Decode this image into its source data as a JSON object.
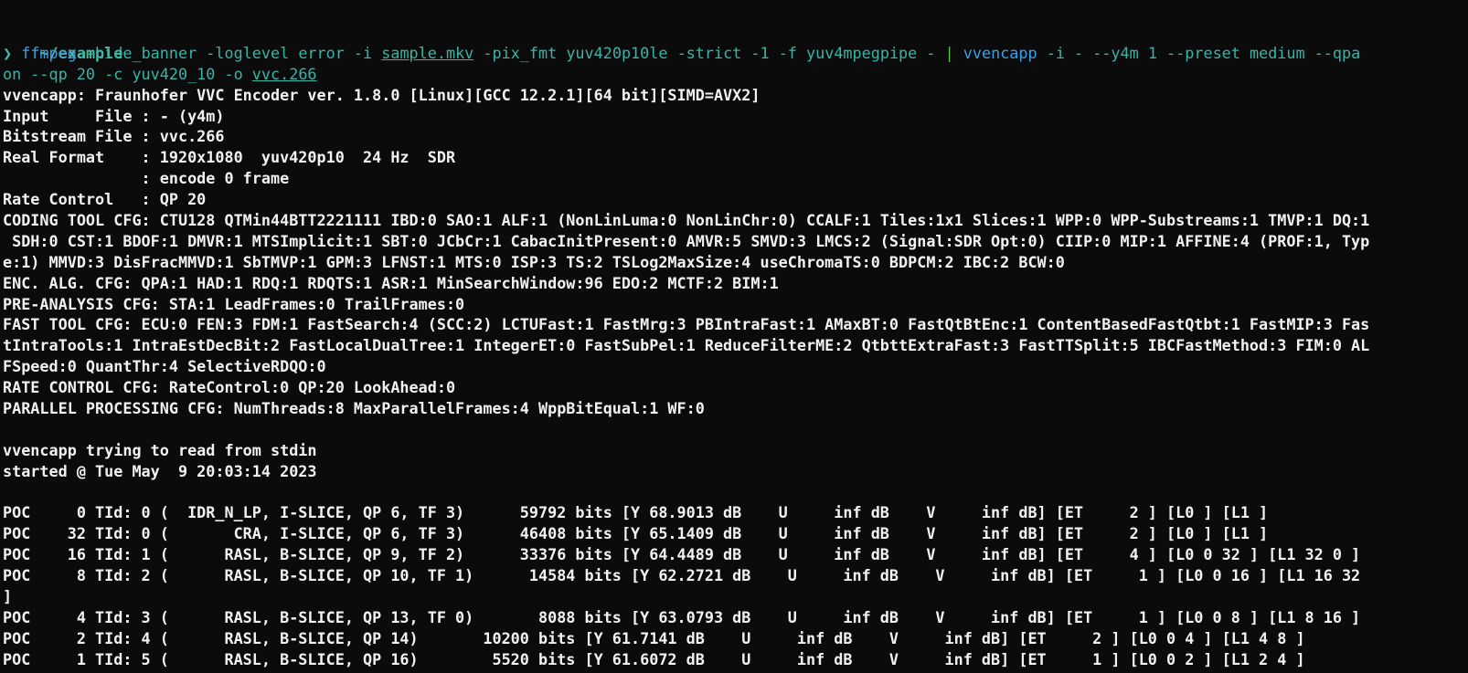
{
  "cwd": "~/example",
  "prompt_symbol": "❯",
  "command": {
    "line1_cmd1": "ffmpeg",
    "line1_args1": " -hide_banner -loglevel error -i ",
    "line1_file1": "sample.mkv",
    "line1_args2": " -pix_fmt yuv420p10le -strict -1 -f yuv4mpegpipe - ",
    "pipe": "|",
    "line1_cmd2": " vvencapp",
    "line1_args3": " -i - --y4m 1 --preset medium --qpa",
    "line2_args": "on --qp 20 -c yuv420_10 -o ",
    "line2_file": "vvc.266"
  },
  "output_lines": [
    "vvencapp: Fraunhofer VVC Encoder ver. 1.8.0 [Linux][GCC 12.2.1][64 bit][SIMD=AVX2]",
    "Input     File : - (y4m)",
    "Bitstream File : vvc.266",
    "Real Format    : 1920x1080  yuv420p10  24 Hz  SDR",
    "               : encode 0 frame",
    "Rate Control   : QP 20",
    "CODING TOOL CFG: CTU128 QTMin44BTT2221111 IBD:0 SAO:1 ALF:1 (NonLinLuma:0 NonLinChr:0) CCALF:1 Tiles:1x1 Slices:1 WPP:0 WPP-Substreams:1 TMVP:1 DQ:1",
    " SDH:0 CST:1 BDOF:1 DMVR:1 MTSImplicit:1 SBT:0 JCbCr:1 CabacInitPresent:0 AMVR:5 SMVD:3 LMCS:2 (Signal:SDR Opt:0) CIIP:0 MIP:1 AFFINE:4 (PROF:1, Typ",
    "e:1) MMVD:3 DisFracMMVD:1 SbTMVP:1 GPM:3 LFNST:1 MTS:0 ISP:3 TS:2 TSLog2MaxSize:4 useChromaTS:0 BDPCM:2 IBC:2 BCW:0",
    "ENC. ALG. CFG: QPA:1 HAD:1 RDQ:1 RDQTS:1 ASR:1 MinSearchWindow:96 EDO:2 MCTF:2 BIM:1",
    "PRE-ANALYSIS CFG: STA:1 LeadFrames:0 TrailFrames:0",
    "FAST TOOL CFG: ECU:0 FEN:3 FDM:1 FastSearch:4 (SCC:2) LCTUFast:1 FastMrg:3 PBIntraFast:1 AMaxBT:0 FastQtBtEnc:1 ContentBasedFastQtbt:1 FastMIP:3 Fas",
    "tIntraTools:1 IntraEstDecBit:2 FastLocalDualTree:1 IntegerET:0 FastSubPel:1 ReduceFilterME:2 QtbttExtraFast:3 FastTTSplit:5 IBCFastMethod:3 FIM:0 AL",
    "FSpeed:0 QuantThr:4 SelectiveRDQO:0",
    "RATE CONTROL CFG: RateControl:0 QP:20 LookAhead:0",
    "PARALLEL PROCESSING CFG: NumThreads:8 MaxParallelFrames:4 WppBitEqual:1 WF:0",
    "",
    "vvencapp trying to read from stdin",
    "started @ Tue May  9 20:03:14 2023",
    "",
    "POC     0 TId: 0 (  IDR_N_LP, I-SLICE, QP 6, TF 3)      59792 bits [Y 68.9013 dB    U     inf dB    V     inf dB] [ET     2 ] [L0 ] [L1 ]",
    "POC    32 TId: 0 (       CRA, I-SLICE, QP 6, TF 3)      46408 bits [Y 65.1409 dB    U     inf dB    V     inf dB] [ET     2 ] [L0 ] [L1 ]",
    "POC    16 TId: 1 (      RASL, B-SLICE, QP 9, TF 2)      33376 bits [Y 64.4489 dB    U     inf dB    V     inf dB] [ET     4 ] [L0 0 32 ] [L1 32 0 ]",
    "POC     8 TId: 2 (      RASL, B-SLICE, QP 10, TF 1)      14584 bits [Y 62.2721 dB    U     inf dB    V     inf dB] [ET     1 ] [L0 0 16 ] [L1 16 32",
    "]",
    "POC     4 TId: 3 (      RASL, B-SLICE, QP 13, TF 0)       8088 bits [Y 63.0793 dB    U     inf dB    V     inf dB] [ET     1 ] [L0 0 8 ] [L1 8 16 ]",
    "POC     2 TId: 4 (      RASL, B-SLICE, QP 14)       10200 bits [Y 61.7141 dB    U     inf dB    V     inf dB] [ET     2 ] [L0 0 4 ] [L1 4 8 ]",
    "POC     1 TId: 5 (      RASL, B-SLICE, QP 16)        5520 bits [Y 61.6072 dB    U     inf dB    V     inf dB] [ET     1 ] [L0 0 2 ] [L1 2 4 ]"
  ],
  "colors": {
    "background": "#0b0b0b",
    "foreground": "#f2f2f2",
    "cwd": "#3fc1a7",
    "command": "#3aa0e8",
    "argument": "#37b5a8",
    "pipe": "#54c23b"
  }
}
